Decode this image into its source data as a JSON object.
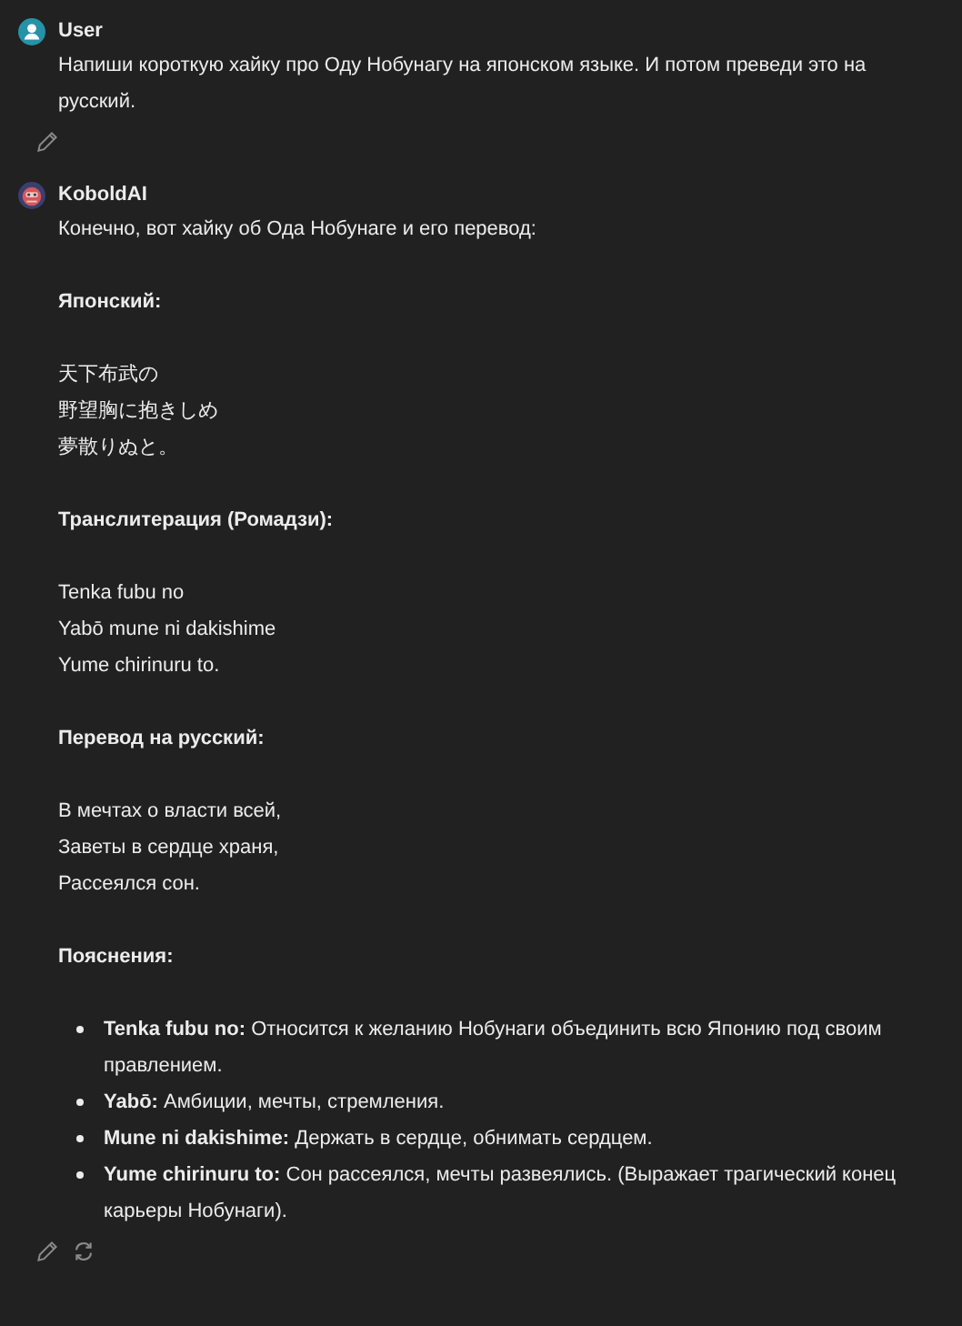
{
  "messages": [
    {
      "kind": "user",
      "author": "User",
      "blocks": [
        {
          "kind": "paragraph",
          "text": "Напиши короткую хайку про Оду Нобунагу на японском языке. И потом преведи это на русский."
        }
      ],
      "actions": [
        {
          "kind": "edit"
        }
      ]
    },
    {
      "kind": "assistant",
      "author": "KoboldAI",
      "blocks": [
        {
          "kind": "paragraph",
          "text": "Конечно, вот хайку об Ода Нобунаге и его перевод:"
        },
        {
          "kind": "heading",
          "text": "Японский:"
        },
        {
          "kind": "lines",
          "lines": [
            "天下布武の",
            "野望胸に抱きしめ",
            "夢散りぬと。"
          ]
        },
        {
          "kind": "heading",
          "text": "Транслитерация (Ромадзи):"
        },
        {
          "kind": "lines",
          "lines": [
            "Tenka fubu no",
            "Yabō mune ni dakishime",
            "Yume chirinuru to."
          ]
        },
        {
          "kind": "heading",
          "text": "Перевод на русский:"
        },
        {
          "kind": "lines",
          "lines": [
            "В мечтах о власти всей,",
            "Заветы в сердце храня,",
            "Рассеялся сон."
          ]
        },
        {
          "kind": "heading",
          "text": "Пояснения:"
        },
        {
          "kind": "bullets",
          "items": [
            "**Tenka fubu no:**  Относится к желанию Нобунаги объединить всю Японию под своим правлением.",
            "**Yabō:** Амбиции, мечты, стремления.",
            "**Mune ni dakishime:** Держать в сердце, обнимать сердцем.",
            "**Yume chirinuru to:** Сон рассеялся, мечты развеялись. (Выражает трагический конец карьеры Нобунаги)."
          ]
        }
      ],
      "actions": [
        {
          "kind": "edit"
        },
        {
          "kind": "regenerate"
        }
      ]
    }
  ]
}
